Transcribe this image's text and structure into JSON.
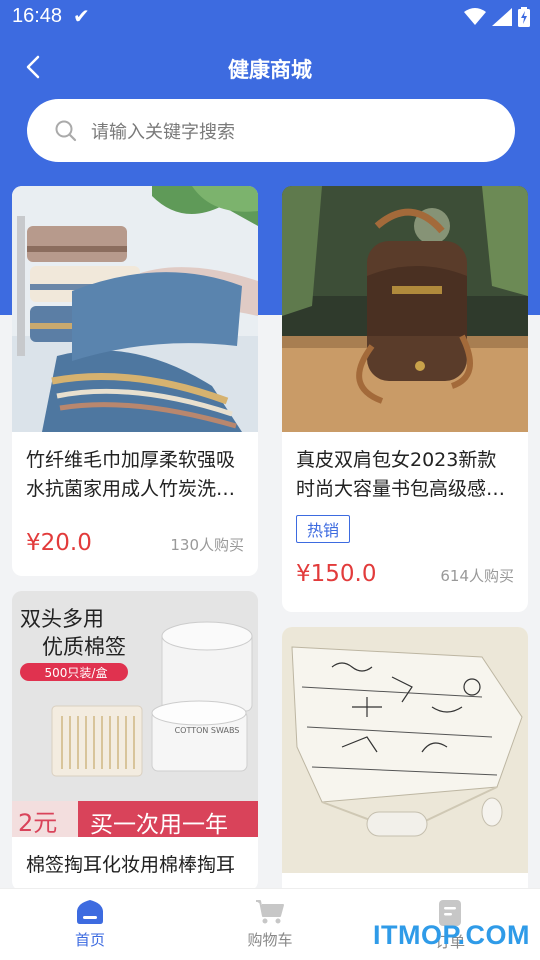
{
  "status": {
    "time": "16:48"
  },
  "header": {
    "title": "健康商城"
  },
  "search": {
    "placeholder": "请输入关键字搜索"
  },
  "products": [
    {
      "title": "竹纤维毛巾加厚柔软强吸水抗菌家用成人竹炭洗…",
      "price": "¥20.0",
      "sales": "130人购买",
      "badge": ""
    },
    {
      "title": "真皮双肩包女2023新款时尚大容量书包高级感…",
      "price": "¥150.0",
      "sales": "614人购买",
      "badge": "热销"
    },
    {
      "title": "棉签掏耳化妆用棉棒掏耳",
      "price": "",
      "sales": "",
      "badge": "",
      "image_text": {
        "line1": "双头多用",
        "line2": "优质棉签",
        "tag": "500只装/盒",
        "price_text": "2元",
        "slogan": "买一次用一年",
        "box_text": "COTTON SWABS"
      }
    },
    {
      "title": "",
      "price": "",
      "sales": "",
      "badge": ""
    }
  ],
  "tabbar": {
    "items": [
      {
        "label": "首页"
      },
      {
        "label": "购物车"
      },
      {
        "label": "订单"
      }
    ]
  },
  "watermark": "ITMOP.COM",
  "colors": {
    "primary": "#3d6be0",
    "price": "#e23b3b"
  }
}
